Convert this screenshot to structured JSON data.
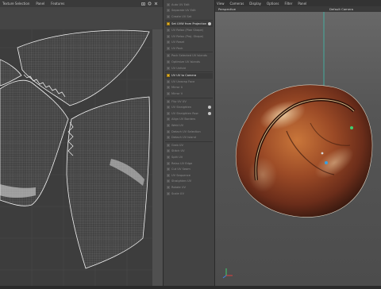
{
  "uv_editor": {
    "menu": [
      "Texture Selection",
      "Panel",
      "Features"
    ],
    "toolbar_icons": [
      "camera-icon",
      "settings-icon",
      "close-icon"
    ]
  },
  "uv_menu": {
    "items": [
      {
        "label": "Auto UV Edit",
        "selected": false,
        "has_option": false
      },
      {
        "label": "Separate UV Edit",
        "selected": false,
        "has_option": false
      },
      {
        "label": "Create UV Set",
        "selected": false,
        "has_option": false
      },
      {
        "label": "Set UVW from Projection",
        "selected": true,
        "has_option": true
      },
      {
        "label": "UV Relax (Plan Shape)",
        "selected": false,
        "has_option": false
      },
      {
        "label": "UV Relax (Proj. Shape)",
        "selected": false,
        "has_option": false
      },
      {
        "label": "UV Reset",
        "selected": false,
        "has_option": false
      },
      {
        "label": "UV Pack",
        "selected": false,
        "has_option": false
      },
      {
        "label": "Pack Selected UV Islands",
        "selected": false,
        "has_option": false
      },
      {
        "label": "Optimize UV Islands",
        "selected": false,
        "has_option": false
      },
      {
        "label": "UV Unfold",
        "selected": false,
        "has_option": false
      },
      {
        "label": "UV UV to Camera",
        "selected": true,
        "has_option": false
      },
      {
        "label": "UV Unwrap Face",
        "selected": false,
        "has_option": false
      },
      {
        "label": "Mirror U",
        "selected": false,
        "has_option": false
      },
      {
        "label": "Mirror V",
        "selected": false,
        "has_option": false
      },
      {
        "label": "Flip UV UV",
        "selected": false,
        "has_option": false
      },
      {
        "label": "UV Straighten",
        "selected": false,
        "has_option": true
      },
      {
        "label": "UV Straighten Row",
        "selected": false,
        "has_option": true
      },
      {
        "label": "Align UV Borders",
        "selected": false,
        "has_option": false
      },
      {
        "label": "Weld UV",
        "selected": false,
        "has_option": false
      },
      {
        "label": "Detach UV Selection",
        "selected": false,
        "has_option": false
      },
      {
        "label": "Detach UV Island",
        "selected": false,
        "has_option": false
      },
      {
        "label": "Grab UV",
        "selected": false,
        "has_option": false
      },
      {
        "label": "Stitch UV",
        "selected": false,
        "has_option": false
      },
      {
        "label": "Split UV",
        "selected": false,
        "has_option": false
      },
      {
        "label": "Relax UV Edge",
        "selected": false,
        "has_option": false
      },
      {
        "label": "Cut UV Seam",
        "selected": false,
        "has_option": false
      },
      {
        "label": "UV Sequence",
        "selected": false,
        "has_option": false
      },
      {
        "label": "Straighten UV",
        "selected": false,
        "has_option": false
      },
      {
        "label": "Rotate UV",
        "selected": false,
        "has_option": false
      },
      {
        "label": "Scale UV",
        "selected": false,
        "has_option": false
      }
    ]
  },
  "viewport": {
    "menu": [
      "View",
      "Cameras",
      "Display",
      "Options",
      "Filter",
      "Panel"
    ],
    "view_name": "Perspective",
    "camera_name": "Default Camera"
  }
}
